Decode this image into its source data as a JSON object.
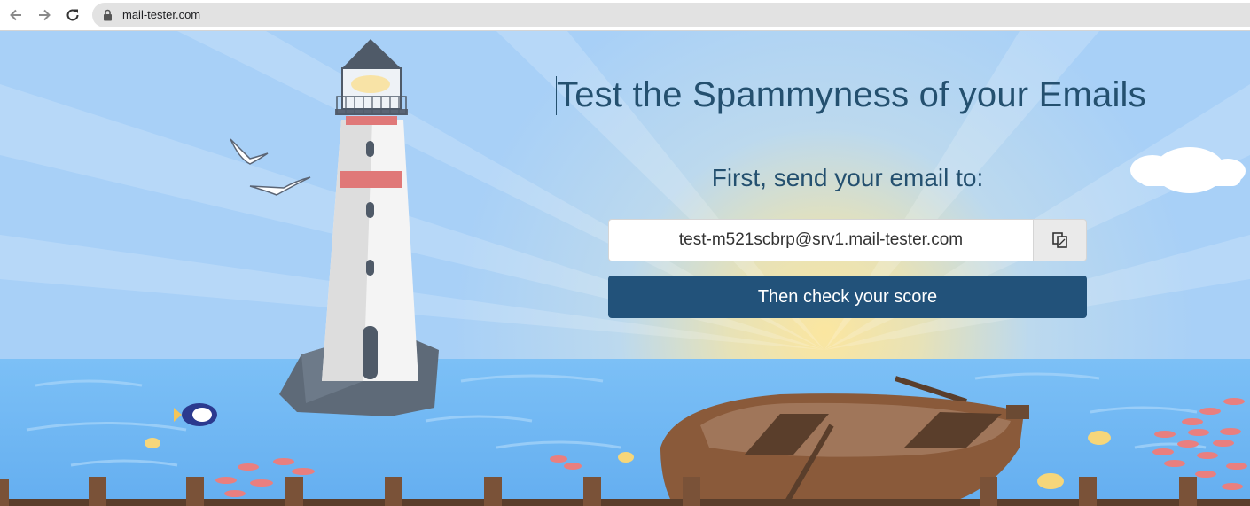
{
  "browser": {
    "url": "mail-tester.com",
    "back_icon": "arrow-left-icon",
    "forward_icon": "arrow-right-icon",
    "reload_icon": "reload-icon",
    "lock_icon": "lock-icon"
  },
  "hero": {
    "headline": "Test the Spammyness of your Emails",
    "subheadline": "First, send your email to:",
    "email_address": "test-m521scbrp@srv1.mail-tester.com",
    "copy_icon": "copy-icon",
    "check_button_label": "Then check your score"
  },
  "colors": {
    "headline": "#24506f",
    "button": "#22527a",
    "sky": "#a9d1f7",
    "sea": "#6fb6f5",
    "sun_glow": "#f5d98a"
  }
}
